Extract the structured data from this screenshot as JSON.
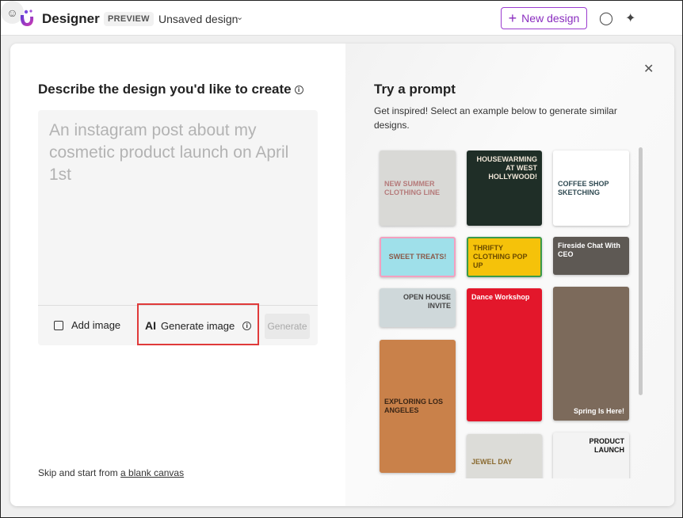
{
  "header": {
    "brand": "Designer",
    "badge": "PREVIEW",
    "design_name": "Unsaved design",
    "new_design": "New design"
  },
  "left": {
    "title": "Describe the design you'd like to create",
    "placeholder": "An instagram post about my cosmetic product launch on April 1st",
    "add_image": "Add image",
    "generate_image_icon": "AI",
    "generate_image": "Generate image",
    "generate": "Generate",
    "skip_text": "Skip and start from ",
    "skip_link": "a blank canvas"
  },
  "right": {
    "title": "Try a prompt",
    "subtitle": "Get inspired! Select an example below to generate similar designs.",
    "templates": [
      {
        "title": "NEW SUMMER CLOTHING LINE",
        "bg": "#d9d9d6",
        "fg": "#b57a7a"
      },
      {
        "title": "HOUSEWARMING AT WEST HOLLYWOOD!",
        "bg": "#1f2e27",
        "fg": "#f0e6d8"
      },
      {
        "title": "COFFEE SHOP SKETCHING",
        "bg": "#ffffff",
        "fg": "#2f4a52"
      },
      {
        "title": "SWEET TREATS!",
        "bg": "#9fe0ea",
        "fg": "#8a5a4a"
      },
      {
        "title": "THRIFTY CLOTHING POP UP",
        "bg": "#f5c20a",
        "fg": "#6a4a00"
      },
      {
        "title": "Fireside Chat With CEO",
        "bg": "#5e5954",
        "fg": "#ffffff"
      },
      {
        "title": "OPEN HOUSE INVITE",
        "bg": "#cfd8da",
        "fg": "#444444"
      },
      {
        "title": "Dance Workshop",
        "bg": "#e3172b",
        "fg": "#ffffff"
      },
      {
        "title": "Spring Is Here!",
        "bg": "#7c6a5b",
        "fg": "#ffffff"
      },
      {
        "title": "EXPLORING LOS ANGELES",
        "bg": "#c9814a",
        "fg": "#3a2515"
      },
      {
        "title": "JEWEL DAY",
        "bg": "#dcdcd8",
        "fg": "#8a6a30"
      },
      {
        "title": "PRODUCT LAUNCH",
        "bg": "#f3f3f3",
        "fg": "#111111"
      }
    ]
  }
}
